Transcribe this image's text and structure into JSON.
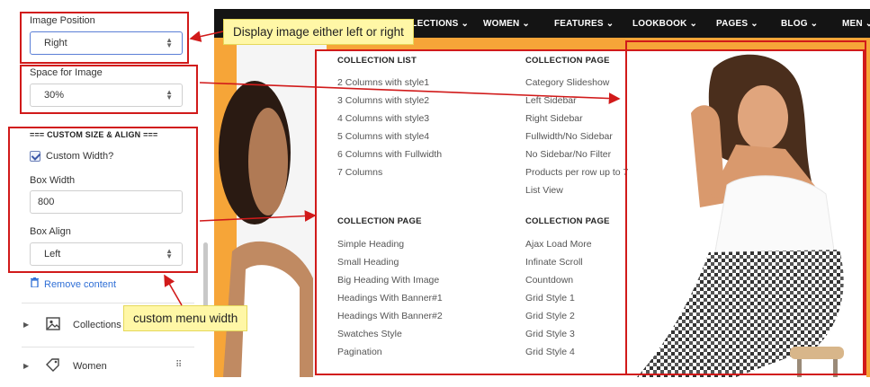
{
  "panel": {
    "image_position": {
      "label": "Image Position",
      "value": "Right"
    },
    "space_for_image": {
      "label": "Space for Image",
      "value": "30%"
    },
    "custom_heading": "=== CUSTOM SIZE & ALIGN ===",
    "custom_width": {
      "label": "Custom Width?",
      "checked": true
    },
    "box_width": {
      "label": "Box Width",
      "value": "800"
    },
    "box_align": {
      "label": "Box Align",
      "value": "Left"
    },
    "remove_content": "Remove content",
    "nav_items": [
      {
        "label": "Collections",
        "icon": "image-icon"
      },
      {
        "label": "Women",
        "icon": "tag-icon"
      }
    ]
  },
  "site_nav": {
    "items": [
      "LLECTIONS ⌄",
      "WOMEN ⌄",
      "FEATURES ⌄",
      "LOOKBOOK ⌄",
      "PAGES ⌄",
      "BLOG ⌄",
      "MEN ⌄"
    ]
  },
  "mega_menu": {
    "columns": [
      {
        "title": "COLLECTION LIST",
        "links": [
          "2 Columns with style1",
          "3 Columns with style2",
          "4 Columns with style3",
          "5 Columns with style4",
          "6 Columns with Fullwidth",
          "7 Columns"
        ]
      },
      {
        "title": "COLLECTION PAGE",
        "links": [
          "Category Slideshow",
          "Left Sidebar",
          "Right Sidebar",
          "Fullwidth/No Sidebar",
          "No Sidebar/No Filter",
          "Products per row up to 7",
          "List View"
        ]
      },
      {
        "title": "COLLECTION PAGE",
        "links": [
          "Simple Heading",
          "Small Heading",
          "Big Heading With Image",
          "Headings With Banner#1",
          "Headings With Banner#2",
          "Swatches Style",
          "Pagination"
        ]
      },
      {
        "title": "COLLECTION PAGE",
        "links": [
          "Ajax Load More",
          "Infinate Scroll",
          "Countdown",
          "Grid Style 1",
          "Grid Style 2",
          "Grid Style 3",
          "Grid Style 4"
        ]
      }
    ]
  },
  "callouts": {
    "display_image": "Display image either left or right",
    "custom_menu_width": "custom menu width"
  },
  "colors": {
    "annotation_red": "#d11a1a",
    "callout_yellow": "#fff7a6",
    "nav_black": "#141414",
    "hero_orange": "#f6a538",
    "link_blue": "#2f6fd6"
  }
}
